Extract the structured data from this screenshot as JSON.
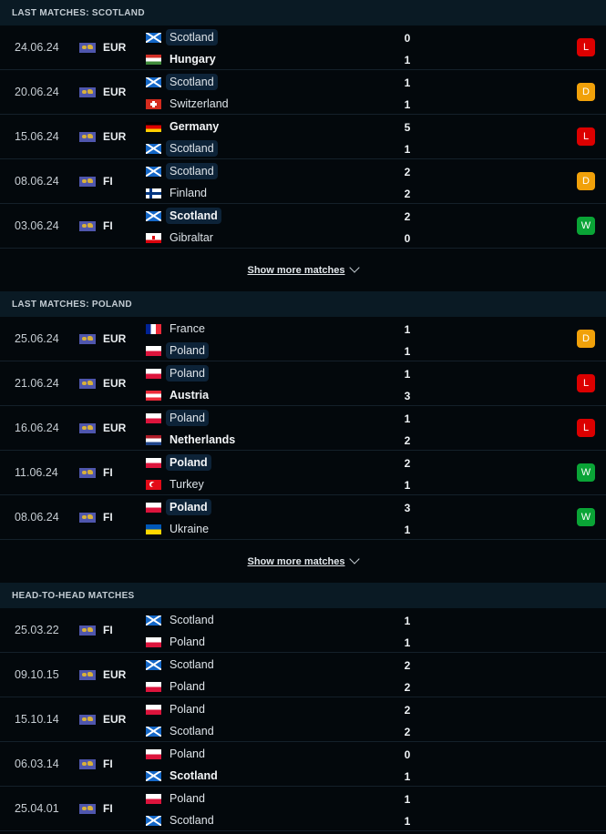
{
  "sections": [
    {
      "title": "LAST MATCHES: SCOTLAND",
      "show_more": "Show more matches",
      "matches": [
        {
          "date": "24.06.24",
          "comp": "EUR",
          "home": {
            "name": "Scotland",
            "flag": "scotland",
            "highlight": true,
            "bold": false
          },
          "away": {
            "name": "Hungary",
            "flag": "hungary",
            "highlight": false,
            "bold": true
          },
          "home_score": "0",
          "away_score": "1",
          "result": "L"
        },
        {
          "date": "20.06.24",
          "comp": "EUR",
          "home": {
            "name": "Scotland",
            "flag": "scotland",
            "highlight": true,
            "bold": false
          },
          "away": {
            "name": "Switzerland",
            "flag": "switzerland",
            "highlight": false,
            "bold": false
          },
          "home_score": "1",
          "away_score": "1",
          "result": "D"
        },
        {
          "date": "15.06.24",
          "comp": "EUR",
          "home": {
            "name": "Germany",
            "flag": "germany",
            "highlight": false,
            "bold": true
          },
          "away": {
            "name": "Scotland",
            "flag": "scotland",
            "highlight": true,
            "bold": false
          },
          "home_score": "5",
          "away_score": "1",
          "result": "L"
        },
        {
          "date": "08.06.24",
          "comp": "FI",
          "home": {
            "name": "Scotland",
            "flag": "scotland",
            "highlight": true,
            "bold": false
          },
          "away": {
            "name": "Finland",
            "flag": "finland",
            "highlight": false,
            "bold": false
          },
          "home_score": "2",
          "away_score": "2",
          "result": "D"
        },
        {
          "date": "03.06.24",
          "comp": "FI",
          "home": {
            "name": "Scotland",
            "flag": "scotland",
            "highlight": true,
            "bold": true
          },
          "away": {
            "name": "Gibraltar",
            "flag": "gibraltar",
            "highlight": false,
            "bold": false
          },
          "home_score": "2",
          "away_score": "0",
          "result": "W"
        }
      ]
    },
    {
      "title": "LAST MATCHES: POLAND",
      "show_more": "Show more matches",
      "matches": [
        {
          "date": "25.06.24",
          "comp": "EUR",
          "home": {
            "name": "France",
            "flag": "france",
            "highlight": false,
            "bold": false
          },
          "away": {
            "name": "Poland",
            "flag": "poland",
            "highlight": true,
            "bold": false
          },
          "home_score": "1",
          "away_score": "1",
          "result": "D"
        },
        {
          "date": "21.06.24",
          "comp": "EUR",
          "home": {
            "name": "Poland",
            "flag": "poland",
            "highlight": true,
            "bold": false
          },
          "away": {
            "name": "Austria",
            "flag": "austria",
            "highlight": false,
            "bold": true
          },
          "home_score": "1",
          "away_score": "3",
          "result": "L"
        },
        {
          "date": "16.06.24",
          "comp": "EUR",
          "home": {
            "name": "Poland",
            "flag": "poland",
            "highlight": true,
            "bold": false
          },
          "away": {
            "name": "Netherlands",
            "flag": "netherlands",
            "highlight": false,
            "bold": true
          },
          "home_score": "1",
          "away_score": "2",
          "result": "L"
        },
        {
          "date": "11.06.24",
          "comp": "FI",
          "home": {
            "name": "Poland",
            "flag": "poland",
            "highlight": true,
            "bold": true
          },
          "away": {
            "name": "Turkey",
            "flag": "turkey",
            "highlight": false,
            "bold": false
          },
          "home_score": "2",
          "away_score": "1",
          "result": "W"
        },
        {
          "date": "08.06.24",
          "comp": "FI",
          "home": {
            "name": "Poland",
            "flag": "poland",
            "highlight": true,
            "bold": true
          },
          "away": {
            "name": "Ukraine",
            "flag": "ukraine",
            "highlight": false,
            "bold": false
          },
          "home_score": "3",
          "away_score": "1",
          "result": "W"
        }
      ]
    },
    {
      "title": "HEAD-TO-HEAD MATCHES",
      "show_more": null,
      "matches": [
        {
          "date": "25.03.22",
          "comp": "FI",
          "home": {
            "name": "Scotland",
            "flag": "scotland",
            "highlight": false,
            "bold": false
          },
          "away": {
            "name": "Poland",
            "flag": "poland",
            "highlight": false,
            "bold": false
          },
          "home_score": "1",
          "away_score": "1",
          "result": null
        },
        {
          "date": "09.10.15",
          "comp": "EUR",
          "home": {
            "name": "Scotland",
            "flag": "scotland",
            "highlight": false,
            "bold": false
          },
          "away": {
            "name": "Poland",
            "flag": "poland",
            "highlight": false,
            "bold": false
          },
          "home_score": "2",
          "away_score": "2",
          "result": null
        },
        {
          "date": "15.10.14",
          "comp": "EUR",
          "home": {
            "name": "Poland",
            "flag": "poland",
            "highlight": false,
            "bold": false
          },
          "away": {
            "name": "Scotland",
            "flag": "scotland",
            "highlight": false,
            "bold": false
          },
          "home_score": "2",
          "away_score": "2",
          "result": null
        },
        {
          "date": "06.03.14",
          "comp": "FI",
          "home": {
            "name": "Poland",
            "flag": "poland",
            "highlight": false,
            "bold": false
          },
          "away": {
            "name": "Scotland",
            "flag": "scotland",
            "highlight": false,
            "bold": true
          },
          "home_score": "0",
          "away_score": "1",
          "result": null
        },
        {
          "date": "25.04.01",
          "comp": "FI",
          "home": {
            "name": "Poland",
            "flag": "poland",
            "highlight": false,
            "bold": false
          },
          "away": {
            "name": "Scotland",
            "flag": "scotland",
            "highlight": false,
            "bold": false
          },
          "home_score": "1",
          "away_score": "1",
          "result": null
        }
      ]
    }
  ],
  "colors": {
    "loss": "#dc0000",
    "draw": "#f1a10a",
    "win": "#0aa436",
    "highlight": "#0d2338",
    "header_bg": "#0a1a24",
    "page_bg": "#03080c"
  }
}
